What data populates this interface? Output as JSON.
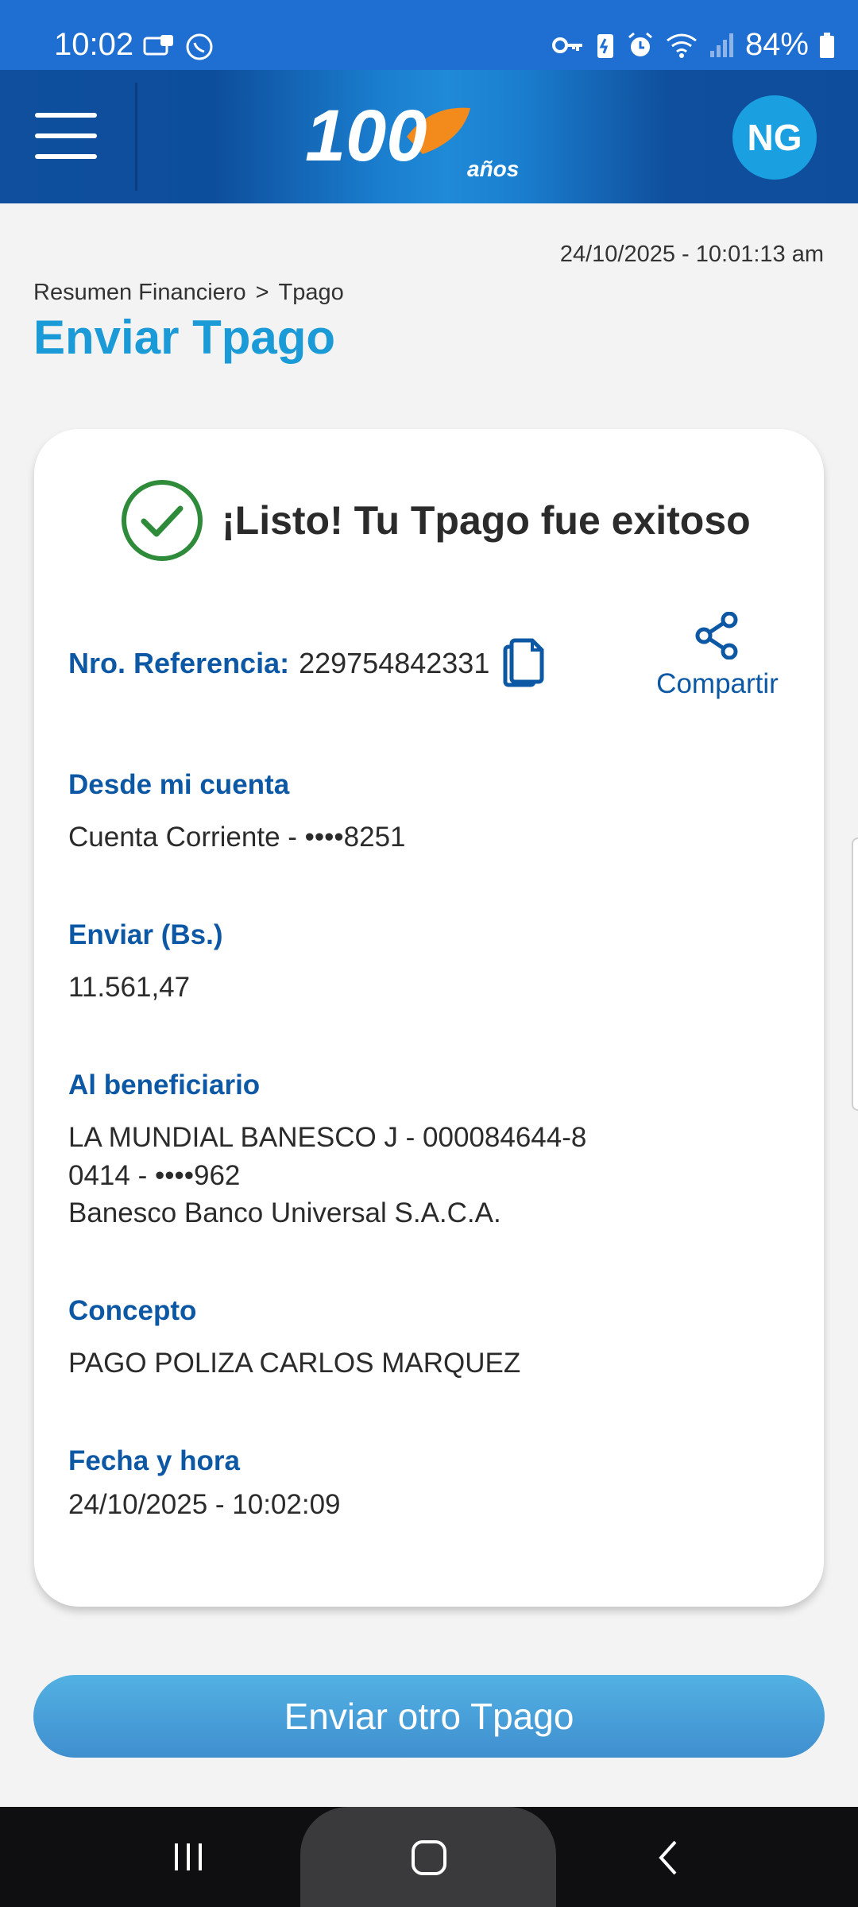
{
  "status_bar": {
    "time": "10:02",
    "battery": "84%",
    "left_icons": [
      "notification-icon",
      "whatsapp-icon"
    ],
    "right_icons": [
      "key-icon",
      "battery-saver-icon",
      "alarm-icon",
      "wifi-icon",
      "signal-icon",
      "battery-icon"
    ]
  },
  "header": {
    "logo_text": "100",
    "logo_subtext": "años",
    "avatar_initials": "NG"
  },
  "page": {
    "timestamp": "24/10/2025 - 10:01:13 am",
    "breadcrumb": [
      "Resumen Financiero",
      ">",
      "Tpago"
    ],
    "title": "Enviar Tpago"
  },
  "card": {
    "success_title": "¡Listo! Tu Tpago fue exitoso",
    "reference_label": "Nro. Referencia:",
    "reference_value": "229754842331",
    "share_label": "Compartir",
    "from_label": "Desde mi cuenta",
    "from_value": "Cuenta Corriente - ••••8251",
    "amount_label": "Enviar (Bs.)",
    "amount_value": "11.561,47",
    "beneficiary_label": "Al beneficiario",
    "beneficiary_lines": [
      "LA MUNDIAL BANESCO J - 000084644-8",
      "0414 - ••••962",
      "Banesco Banco Universal S.A.C.A."
    ],
    "concept_label": "Concepto",
    "concept_value": "PAGO POLIZA CARLOS MARQUEZ",
    "datetime_label": "Fecha y hora",
    "datetime_value": "24/10/2025 - 10:02:09"
  },
  "actions": {
    "send_another": "Enviar otro Tpago"
  },
  "colors": {
    "brand_blue": "#0d58a4",
    "title_blue": "#1a9ad6",
    "success_green": "#2e8b3a",
    "button_blue": "#4aa3dc"
  }
}
